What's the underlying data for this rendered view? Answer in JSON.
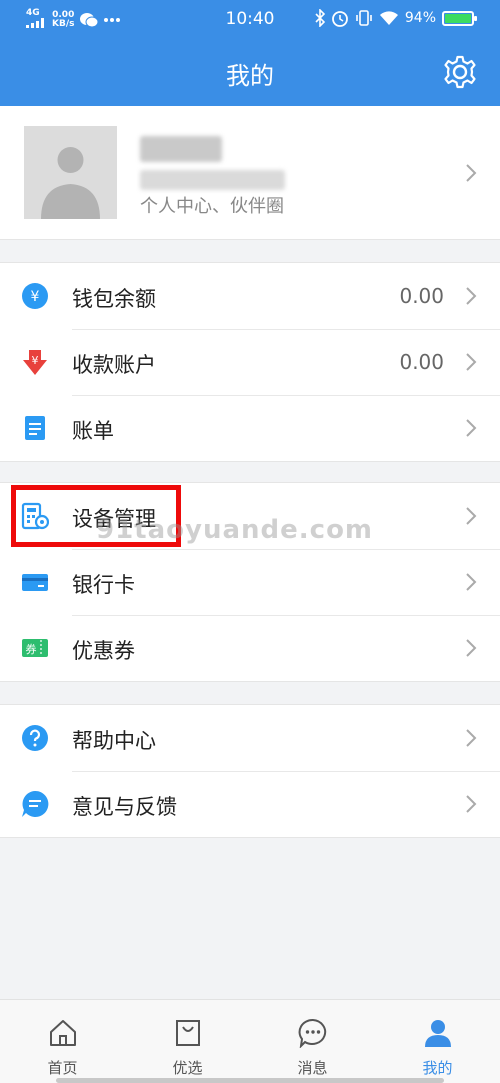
{
  "status_bar": {
    "network": "4G",
    "speed": "0.00",
    "speed_unit": "KB/s",
    "time": "10:40",
    "battery": "94%",
    "battery_level": 0.94
  },
  "header": {
    "title": "我的"
  },
  "profile": {
    "subtitle": "个人中心、伙伴圈"
  },
  "groups": [
    [
      {
        "label": "钱包余额",
        "value": "0.00",
        "icon": "wallet-icon"
      },
      {
        "label": "收款账户",
        "value": "0.00",
        "icon": "receive-account-icon"
      },
      {
        "label": "账单",
        "value": "",
        "icon": "bill-icon"
      }
    ],
    [
      {
        "label": "设备管理",
        "value": "",
        "icon": "device-management-icon"
      },
      {
        "label": "银行卡",
        "value": "",
        "icon": "bank-card-icon"
      },
      {
        "label": "优惠券",
        "value": "",
        "icon": "coupon-icon"
      }
    ],
    [
      {
        "label": "帮助中心",
        "value": "",
        "icon": "help-icon"
      },
      {
        "label": "意见与反馈",
        "value": "",
        "icon": "feedback-icon"
      }
    ]
  ],
  "coupon_icon_text": "券",
  "watermark": "91taoyuande.com",
  "bottom_nav": [
    {
      "label": "首页",
      "icon": "home-icon"
    },
    {
      "label": "优选",
      "icon": "shopping-bag-icon"
    },
    {
      "label": "消息",
      "icon": "message-icon"
    },
    {
      "label": "我的",
      "icon": "user-icon",
      "active": true
    }
  ],
  "colors": {
    "primary": "#3a8ee6",
    "highlight": "#ee0a0a",
    "accent_red": "#e8413c",
    "accent_green": "#2dbd6e"
  }
}
